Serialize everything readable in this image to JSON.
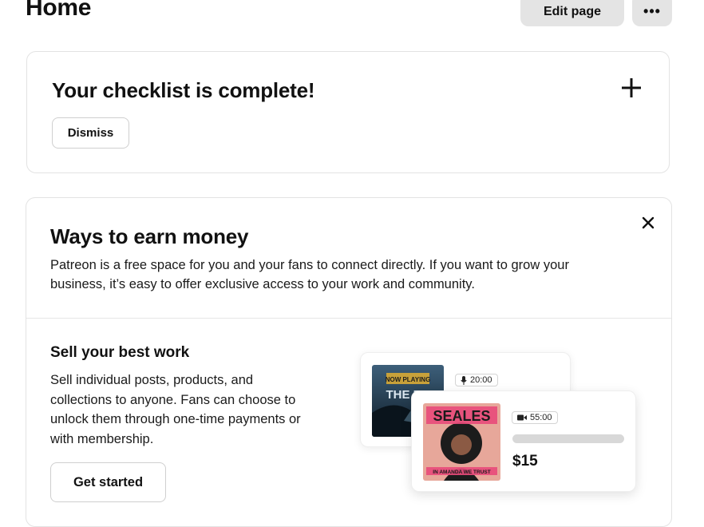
{
  "header": {
    "title": "Home",
    "edit_label": "Edit page",
    "more_label": "•••"
  },
  "checklist": {
    "title": "Your checklist is complete!",
    "dismiss_label": "Dismiss",
    "expand_icon": "plus-icon"
  },
  "earn": {
    "title": "Ways to earn money",
    "description": "Patreon is a free space for you and your fans to connect directly. If you want to grow your business, it’s easy to offer exclusive access to your work and community.",
    "close_icon": "close-icon",
    "sell": {
      "title": "Sell your best work",
      "description": "Sell individual posts, products, and collections to anyone. Fans can choose to unlock them through one-time payments or with membership.",
      "cta_label": "Get started"
    },
    "illustration": {
      "audio_duration": "20:00",
      "audio_icon": "microphone-icon",
      "video_duration": "55:00",
      "video_icon": "video-camera-icon",
      "price": "$15",
      "back_thumb_text": "NOW PLAYING",
      "back_thumb_subtext": "THE RE",
      "front_thumb_text": "SEALES",
      "front_thumb_subtext": "IN AMANDA WE TRUST"
    }
  }
}
